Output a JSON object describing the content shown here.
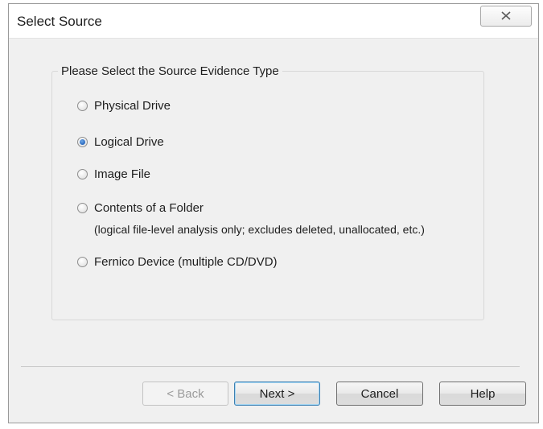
{
  "window": {
    "title": "Select Source",
    "close_icon": "close-icon"
  },
  "group": {
    "label": "Please Select the Source Evidence Type",
    "options": [
      {
        "label": "Physical Drive",
        "checked": false
      },
      {
        "label": "Logical Drive",
        "checked": true
      },
      {
        "label": "Image File",
        "checked": false
      },
      {
        "label": "Contents of a Folder",
        "note": "(logical file-level analysis only; excludes deleted, unallocated, etc.)",
        "checked": false
      },
      {
        "label": "Fernico Device (multiple CD/DVD)",
        "checked": false
      }
    ]
  },
  "buttons": {
    "back": "< Back",
    "next": "Next >",
    "cancel": "Cancel",
    "help": "Help"
  }
}
